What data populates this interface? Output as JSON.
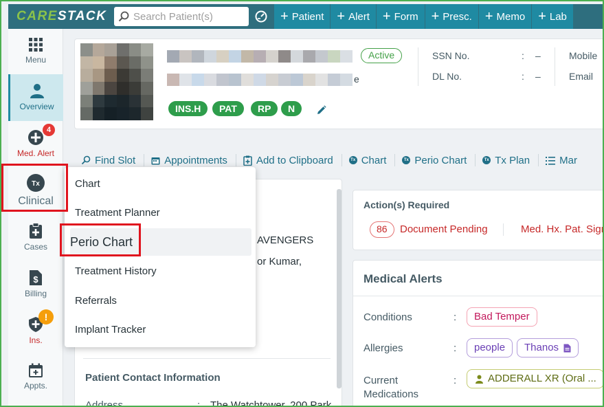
{
  "app": {
    "logo_a": "CARE",
    "logo_b": "STACK"
  },
  "search": {
    "placeholder": "Search Patient(s)"
  },
  "topbar": {
    "buttons": [
      {
        "label": "Patient"
      },
      {
        "label": "Alert"
      },
      {
        "label": "Form"
      },
      {
        "label": "Presc."
      },
      {
        "label": "Memo"
      },
      {
        "label": "Lab"
      }
    ]
  },
  "sidebar": {
    "items": [
      {
        "label": "Menu",
        "icon": "grid-icon"
      },
      {
        "label": "Overview",
        "icon": "person-icon"
      },
      {
        "label": "Med. Alert",
        "icon": "plus-circle-icon",
        "badge": "4"
      },
      {
        "label": "Clinical",
        "icon": "tx-icon"
      },
      {
        "label": "Cases",
        "icon": "clipboard-plus-icon"
      },
      {
        "label": "Billing",
        "icon": "dollar-file-icon"
      },
      {
        "label": "Ins.",
        "icon": "shield-plus-icon",
        "badge": "!"
      },
      {
        "label": "Appts.",
        "icon": "calendar-icon"
      }
    ]
  },
  "patient": {
    "status": "Active",
    "name_tail": "e",
    "tags": [
      "INS.H",
      "PAT",
      "RP",
      "N"
    ],
    "ssn_label": "SSN No.",
    "ssn_value": "–",
    "dl_label": "DL No.",
    "dl_value": "–",
    "mobile_label": "Mobile",
    "email_label": "Email",
    "colon": ":"
  },
  "actions": [
    {
      "label": "Find Slot",
      "icon": "search-icon"
    },
    {
      "label": "Appointments",
      "icon": "calendar-icon"
    },
    {
      "label": "Add to Clipboard",
      "icon": "clipboard-icon"
    },
    {
      "label": "Chart",
      "icon": "tx-icon"
    },
    {
      "label": "Perio Chart",
      "icon": "tx-icon"
    },
    {
      "label": "Tx Plan",
      "icon": "tx-icon"
    },
    {
      "label": "Mar",
      "icon": "list-icon"
    }
  ],
  "left_panel": {
    "line1": "AVENGERS",
    "line2": "or Kumar,",
    "contact_heading": "Patient Contact Information",
    "address_label": "Address",
    "address_value": "The Watchtower, 200 Park"
  },
  "actions_required": {
    "title": "Action(s) Required",
    "count": "86",
    "doc_label": "Document Pending",
    "medhx_label": "Med. Hx. Pat. Sign"
  },
  "medical_alerts": {
    "title": "Medical Alerts",
    "conditions_label": "Conditions",
    "conditions": [
      "Bad Temper"
    ],
    "allergies_label": "Allergies",
    "allergies": [
      "people",
      "Thanos"
    ],
    "medications_label_1": "Current",
    "medications_label_2": "Medications",
    "medications": [
      "ADDERALL XR (Oral ..."
    ]
  },
  "clinical_menu": {
    "items": [
      "Chart",
      "Treatment Planner",
      "Perio Chart",
      "Treatment History",
      "Referrals",
      "Implant Tracker"
    ]
  },
  "colors": {
    "brand": "#1f8aa2",
    "topbar": "#2e6e7e",
    "accent_green": "#43a047",
    "highlight_red": "#e0141e"
  }
}
